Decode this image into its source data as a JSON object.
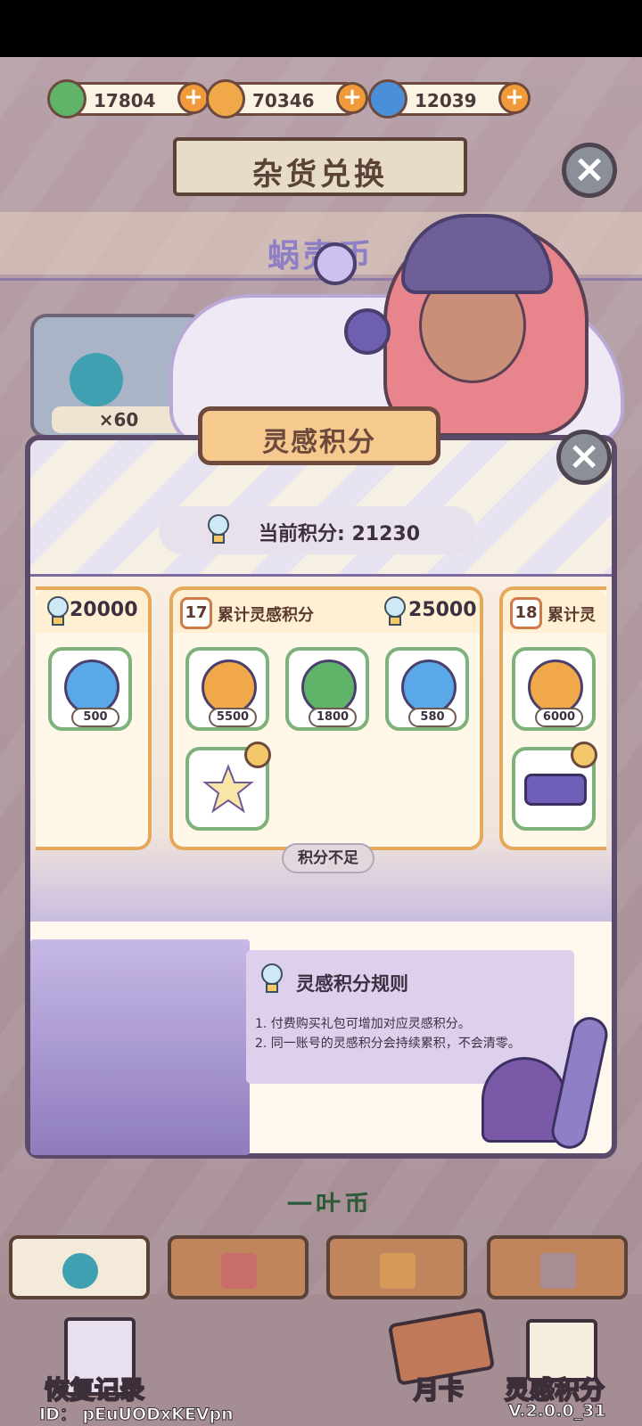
{
  "currencies": [
    {
      "name": "clover",
      "value": "17804",
      "color": "#5fb46a"
    },
    {
      "name": "shell",
      "value": "70346",
      "color": "#f0a848"
    },
    {
      "name": "snail",
      "value": "12039",
      "color": "#4a8fd8"
    }
  ],
  "header": {
    "title": "杂货兑换",
    "subtitle": "蜗壳币",
    "bg_item_qty": "×60"
  },
  "dialog": {
    "title": "灵感积分",
    "current_score": "当前积分: 21230",
    "tiers": [
      {
        "value": "20000",
        "rewards": [
          {
            "icon": "snail-coin",
            "qty": "500"
          }
        ]
      },
      {
        "num": "17",
        "label": "累计灵感积分",
        "value": "25000",
        "rewards": [
          {
            "icon": "shell-coin",
            "qty": "5500"
          },
          {
            "icon": "clover-coin",
            "qty": "1800"
          },
          {
            "icon": "snail-coin",
            "qty": "580"
          }
        ]
      },
      {
        "num": "18",
        "label": "累计灵",
        "rewards": [
          {
            "icon": "shell-coin",
            "qty": "6000"
          }
        ]
      }
    ],
    "insufficient": "积分不足",
    "rules": {
      "title": "灵感积分规则",
      "lines": [
        "1. 付费购买礼包可增加对应灵感积分。",
        "2. 同一账号的灵感积分会持续累积，不会清零。"
      ]
    }
  },
  "background_partial_text": "一叶币",
  "bottom": {
    "restore": "恢复记录",
    "monthly_card": "月卡",
    "inspiration": "灵感积分"
  },
  "footer": {
    "user_id": "ID： pEuUODxKEVpn",
    "version": "V.2.0.0_31"
  },
  "colors": {
    "accent": "#f6c98f",
    "frame": "#5b4a6a",
    "reward_border": "#7fb27a"
  }
}
